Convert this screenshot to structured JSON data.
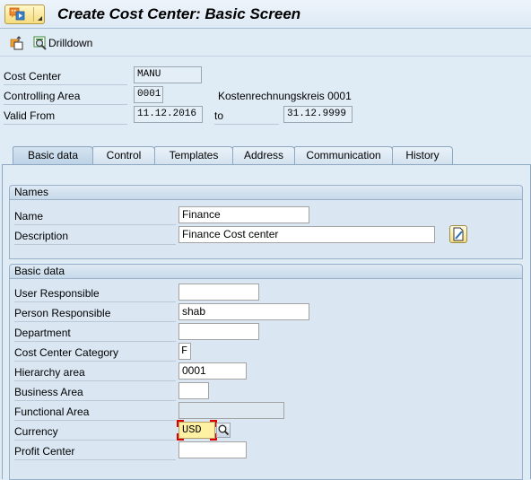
{
  "window": {
    "title": "Create Cost Center: Basic Screen"
  },
  "toolbar": {
    "drilldown_label": "Drilldown"
  },
  "header": {
    "cost_center": {
      "label": "Cost Center",
      "value": "MANU"
    },
    "controlling_area": {
      "label": "Controlling Area",
      "value": "0001",
      "description": "Kostenrechnungskreis 0001"
    },
    "valid_from": {
      "label": "Valid From",
      "value": "11.12.2016",
      "to_label": "to",
      "to_value": "31.12.9999"
    }
  },
  "tabs": [
    {
      "label": "Basic data",
      "active": true
    },
    {
      "label": "Control",
      "active": false
    },
    {
      "label": "Templates",
      "active": false
    },
    {
      "label": "Address",
      "active": false
    },
    {
      "label": "Communication",
      "active": false
    },
    {
      "label": "History",
      "active": false
    }
  ],
  "names_group": {
    "title": "Names",
    "name": {
      "label": "Name",
      "value": "Finance"
    },
    "description": {
      "label": "Description",
      "value": "Finance Cost center"
    }
  },
  "basic_group": {
    "title": "Basic data",
    "fields": [
      {
        "label": "User Responsible",
        "value": ""
      },
      {
        "label": "Person Responsible",
        "value": "shab"
      },
      {
        "label": "Department",
        "value": ""
      },
      {
        "label": "Cost Center Category",
        "value": "F"
      },
      {
        "label": "Hierarchy area",
        "value": "0001"
      },
      {
        "label": "Business Area",
        "value": ""
      },
      {
        "label": "Functional Area",
        "value": ""
      },
      {
        "label": "Currency",
        "value": "USD"
      },
      {
        "label": "Profit Center",
        "value": ""
      }
    ]
  }
}
